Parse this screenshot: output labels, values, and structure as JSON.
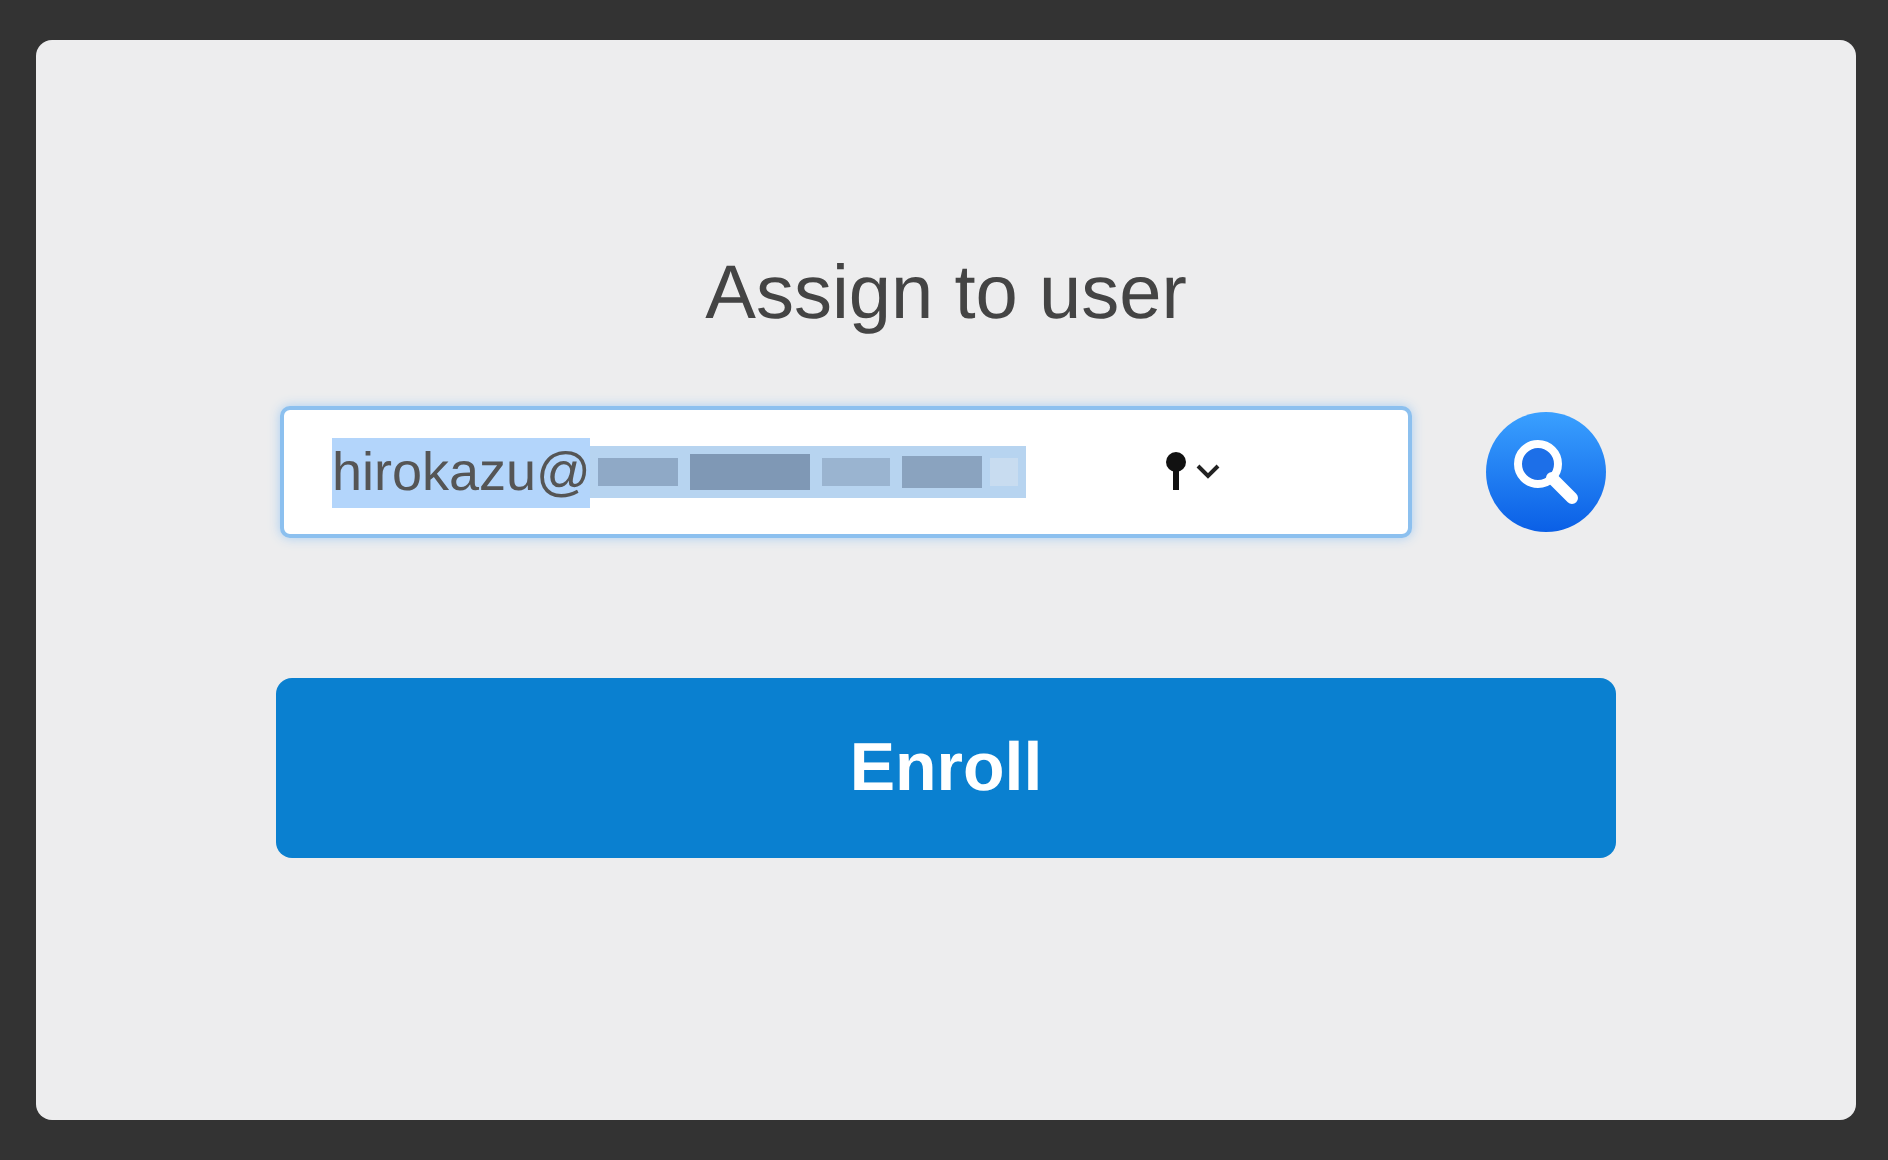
{
  "title": "Assign to user",
  "user_field": {
    "value": "hirokazu@",
    "selected": true,
    "redacted": true
  },
  "enroll_button": {
    "label": "Enroll"
  }
}
